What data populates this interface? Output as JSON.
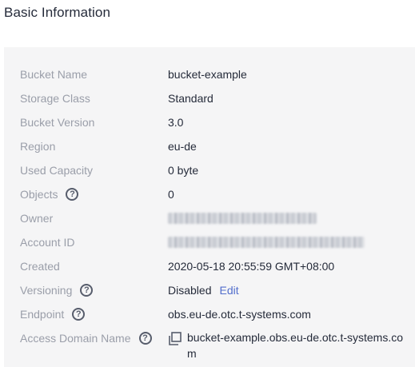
{
  "page_title": "Basic Information",
  "fields": [
    {
      "label": "Bucket Name",
      "value": "bucket-example"
    },
    {
      "label": "Storage Class",
      "value": "Standard"
    },
    {
      "label": "Bucket Version",
      "value": "3.0"
    },
    {
      "label": "Region",
      "value": "eu-de"
    },
    {
      "label": "Used Capacity",
      "value": "0 byte"
    },
    {
      "label": "Objects",
      "value": "0"
    },
    {
      "label": "Owner",
      "value": ""
    },
    {
      "label": "Account ID",
      "value": ""
    },
    {
      "label": "Created",
      "value": "2020-05-18 20:55:59 GMT+08:00"
    },
    {
      "label": "Versioning",
      "value": "Disabled",
      "action": "Edit"
    },
    {
      "label": "Endpoint",
      "value": "obs.eu-de.otc.t-systems.com"
    },
    {
      "label": "Access Domain Name",
      "value": "bucket-example.obs.eu-de.otc.t-systems.com"
    }
  ],
  "help_glyph": "?",
  "icons": {
    "help": "question-circle-icon",
    "copy": "copy-icon"
  },
  "colors": {
    "label": "#9a9ea9",
    "value": "#252b3a",
    "link": "#526ecc",
    "panel_bg": "#f5f5f6"
  }
}
